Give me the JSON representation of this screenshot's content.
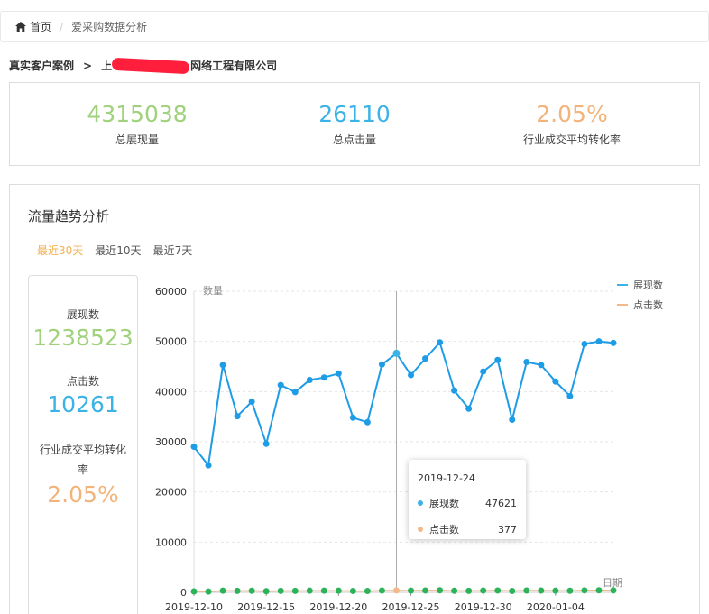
{
  "breadcrumb": {
    "home": "首页",
    "current": "爱采购数据分析"
  },
  "case": {
    "prefix": "真实客户案例",
    "arrow": ">",
    "company_visible": "上",
    "company_suffix": "网络工程有限公司"
  },
  "stats": [
    {
      "value": "4315038",
      "label": "总展现量",
      "color": "#a0d17c"
    },
    {
      "value": "26110",
      "label": "总点击量",
      "color": "#3cb3e6"
    },
    {
      "value": "2.05%",
      "label": "行业成交平均转化率",
      "color": "#f2b47a"
    }
  ],
  "trend": {
    "title": "流量趋势分析",
    "tabs": [
      "最近30天",
      "最近10天",
      "最近7天"
    ],
    "active_tab": 0
  },
  "summary": {
    "impressions_label": "展现数",
    "impressions_value": "1238523",
    "clicks_label": "点击数",
    "clicks_value": "10261",
    "rate_label": "行业成交平均转化率",
    "rate_value": "2.05%"
  },
  "colors": {
    "impressions": "#1e9ce6",
    "clicks_dot": "#2cb35a",
    "clicks_line": "#f4b98a",
    "accent": "#f2b152"
  },
  "chart_data": {
    "type": "line",
    "ylabel": "数量",
    "xlabel": "日期",
    "ylim": [
      0,
      60000
    ],
    "yticks": [
      0,
      10000,
      20000,
      30000,
      40000,
      50000,
      60000
    ],
    "xtick_labels": [
      "2019-12-10",
      "2019-12-15",
      "2019-12-20",
      "2019-12-25",
      "2019-12-30",
      "2020-01-04"
    ],
    "x": [
      "2019-12-10",
      "2019-12-11",
      "2019-12-12",
      "2019-12-13",
      "2019-12-14",
      "2019-12-15",
      "2019-12-16",
      "2019-12-17",
      "2019-12-18",
      "2019-12-19",
      "2019-12-20",
      "2019-12-21",
      "2019-12-22",
      "2019-12-23",
      "2019-12-24",
      "2019-12-25",
      "2019-12-26",
      "2019-12-27",
      "2019-12-28",
      "2019-12-29",
      "2019-12-30",
      "2019-12-31",
      "2020-01-01",
      "2020-01-02",
      "2020-01-03",
      "2020-01-04",
      "2020-01-05",
      "2020-01-06",
      "2020-01-07",
      "2020-01-08"
    ],
    "legend_position": "top-right",
    "series": [
      {
        "name": "展现数",
        "values": [
          29000,
          25300,
          45300,
          35100,
          38000,
          29600,
          41300,
          39900,
          42300,
          42800,
          43600,
          34800,
          33900,
          45400,
          47621,
          43300,
          46600,
          49800,
          40200,
          36600,
          44000,
          46300,
          34400,
          45900,
          45300,
          42000,
          39100,
          49500,
          50000,
          49700
        ]
      },
      {
        "name": "点击数",
        "values": [
          180,
          160,
          330,
          290,
          310,
          230,
          290,
          290,
          330,
          330,
          330,
          270,
          260,
          350,
          377,
          340,
          370,
          400,
          320,
          290,
          350,
          370,
          270,
          360,
          360,
          330,
          310,
          390,
          400,
          390
        ]
      }
    ],
    "tooltip": {
      "date": "2019-12-24",
      "rows": [
        {
          "name": "展现数",
          "value": "47621"
        },
        {
          "name": "点击数",
          "value": "377"
        }
      ]
    }
  }
}
